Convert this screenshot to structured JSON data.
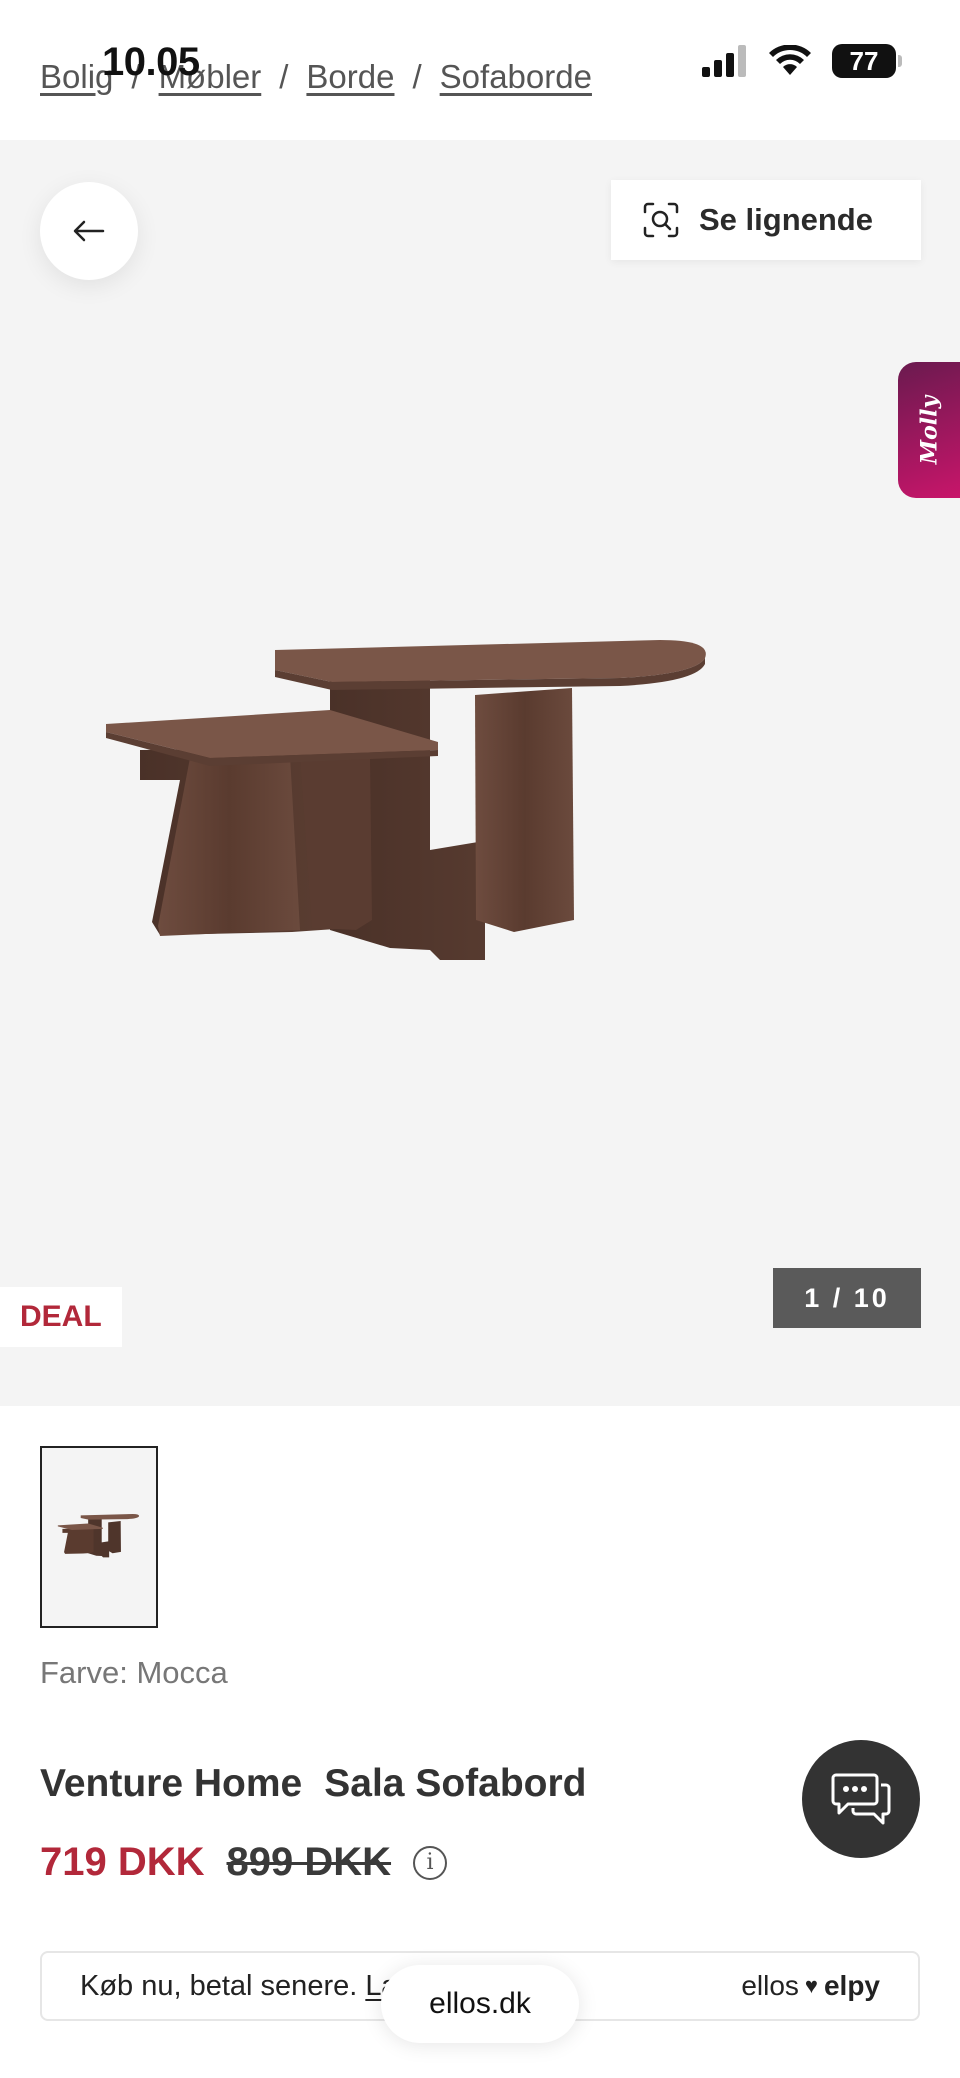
{
  "status_bar": {
    "time": "10.05",
    "battery": "77",
    "icons": [
      "signal-icon",
      "wifi-icon",
      "battery-icon"
    ]
  },
  "breadcrumb": [
    "Bolig",
    "Møbler",
    "Borde",
    "Sofaborde"
  ],
  "breadcrumb_separator": "/",
  "gallery": {
    "similar_label": "Se lignende",
    "molly_label": "Molly",
    "deal_label": "DEAL",
    "counter": "1 / 10"
  },
  "product": {
    "color_label": "Farve:",
    "color_value": "Mocca",
    "brand": "Venture Home",
    "name": "Sala Sofabord",
    "price_now": "719 DKK",
    "price_old": "899 DKK"
  },
  "bnpl": {
    "text": "Køb nu, betal senere. ",
    "link": "Læs mere",
    "logo_left": "ellos",
    "logo_right": "elpy"
  },
  "browser": {
    "url": "ellos.dk"
  },
  "colors": {
    "accent_red": "#b2283a",
    "molly_gradient_start": "#6a1a4f",
    "molly_gradient_end": "#c8156a",
    "counter_bg": "#5a5a5a"
  }
}
